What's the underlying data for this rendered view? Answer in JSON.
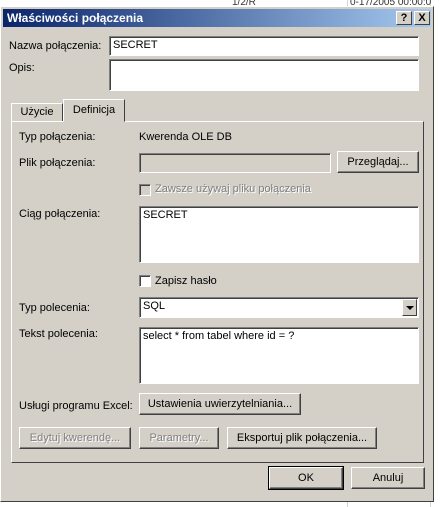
{
  "window": {
    "title": "Właściwości połączenia",
    "help_button": "?",
    "close_button": "X"
  },
  "background": {
    "cell_text": "1/2/R",
    "cell_text2": "0-17/2005 00:00:0"
  },
  "connection_name": {
    "label": "Nazwa połączenia:",
    "value": "SECRET"
  },
  "description": {
    "label": "Opis:",
    "value": ""
  },
  "tabs": [
    {
      "label": "Użycie",
      "active": false
    },
    {
      "label": "Definicja",
      "active": true
    }
  ],
  "definition": {
    "connection_type_label": "Typ połączenia:",
    "connection_type_value": "Kwerenda OLE DB",
    "connection_file_label": "Plik połączenia:",
    "connection_file_value": "",
    "browse_button": "Przeglądaj...",
    "always_use_file_label": "Zawsze używaj pliku połączenia",
    "connection_string_label": "Ciąg połączenia:",
    "connection_string_value": "SECRET",
    "save_password_label": "Zapisz hasło",
    "command_type_label": "Typ polecenia:",
    "command_type_value": "SQL",
    "command_text_label": "Tekst polecenia:",
    "command_text_value": "select * from tabel where id = ?",
    "excel_services_label": "Usługi programu Excel:",
    "auth_settings_button": "Ustawienia uwierzytelniania...",
    "edit_query_button": "Edytuj kwerendę...",
    "parameters_button": "Parametry...",
    "export_button": "Eksportuj plik połączenia..."
  },
  "footer": {
    "ok_button": "OK",
    "cancel_button": "Anuluj"
  }
}
